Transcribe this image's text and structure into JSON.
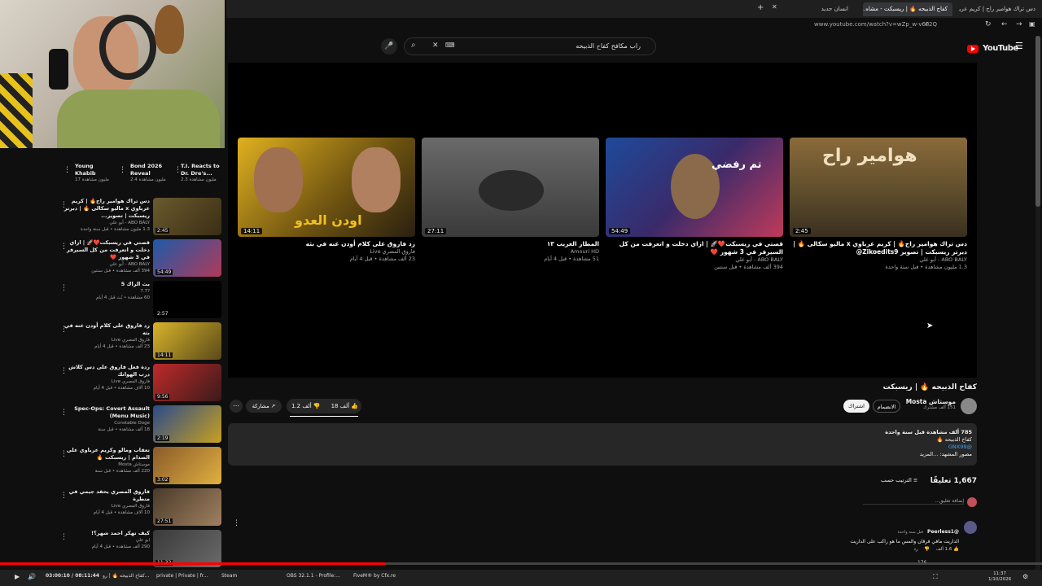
{
  "tabs": [
    {
      "label": "دس تراك هوامير راح | كريم عرباوي x ..."
    },
    {
      "label": "كفاح الذبيحه 🔥 | ريسبكت - مشاه..."
    },
    {
      "label": "انسان جديد"
    }
  ],
  "browser": {
    "url": "www.youtube.com/watch?v=wZp_w-v6F2Q"
  },
  "header": {
    "logo": "YouTube",
    "logo_sup": "SA",
    "search_query": "راب مكافح كفاح الذبيحه"
  },
  "end_screen": [
    {
      "title": "دس تراك هوامير راح🔥 | كريم عرباوي x ماليو سكالى 🔥 | دبرتر ريسبكت | تصوير Zikoedits9@",
      "channel": "ABO BALY - أبو علي",
      "meta": "1.3 مليون مشاهدة • قبل سنة واحدة",
      "duration": "2:45"
    },
    {
      "title": "قصتي في ريسبكت❤️🚀 | ازاي دخلت و اتعرفت من كل السيرفر في 3 شهور ❤️",
      "channel": "ABO BALY - أبو علي",
      "meta": "394 ألف مشاهدة • قبل سنتين",
      "duration": "54:49"
    },
    {
      "title": "المطار الغريب ١٣",
      "channel": "Amouri HD",
      "meta": "51 مشاهدة • قبل 4 أيام",
      "duration": "27:11"
    },
    {
      "title": "رد فاروق على كلام أودن عنه في بثه",
      "channel": "فاروق المصري Live",
      "meta": "23 ألف مشاهدة • قبل 4 أيام",
      "duration": "14:11"
    }
  ],
  "video": {
    "title": "كفاح الذبيحه 🔥 | ريسبكت",
    "channel": "موستاش Mosta",
    "subs": "151 ألف مشترك",
    "join_label": "الانضمام",
    "subscribe_label": "اشتراك",
    "likes": "18 ألف",
    "dislikes": "1.2 ألف",
    "share_label": "مشاركة",
    "desc_views": "785 ألف مشاهدة  قبل سنة واحدة",
    "desc_line1": "كفاح الذبيحه 🔥",
    "desc_handle": "@GNX99",
    "desc_line3": "مصور المشهد: ...المزيد"
  },
  "comments": {
    "count": "1,667 تعليقًا",
    "sort_label": "الترتيب حسب",
    "add_placeholder": "إضافة تعليق...",
    "first_user": "@Peerless1",
    "first_time": "قبل سنة واحدة",
    "first_text": "الداريت مافي فرقان والمس ما هو راكب على الداريت",
    "first_likes": "1.6 ألف",
    "reply_label": "رد",
    "replies_count": "176"
  },
  "sidebar_top": [
    {
      "title": "T.I. Reacts to Dr. Dre's...",
      "meta": "2.3 مليون مشاهدة"
    },
    {
      "title": "Bond 2026 Reveal",
      "meta": "2.4 مليون مشاهدة"
    },
    {
      "title": "Young Khabib",
      "meta": "17 مليون مشاهدة"
    }
  ],
  "sidebar": [
    {
      "title": "دس تراك هوامير راح🔥 | كريم عرباوي x ماليو سكالى 🔥 | دبرتر ريسبكت | تصوير...",
      "channel": "ABO BALY - أبو علي",
      "meta": "1.3 مليون مشاهدة • قبل سنة واحدة",
      "duration": "2:45"
    },
    {
      "title": "قصتي في ريسبكت❤️🚀 | ازاي دخلت و اتعرفت من كل السيرفر في 3 شهور ❤️",
      "channel": "ABO BALY - أبو علي",
      "meta": "394 ألف مشاهدة • قبل سنتين",
      "duration": "54:49"
    },
    {
      "title": "بث الراك 5",
      "channel": "?7.7",
      "meta": "60 مشاهدة • بُث قبل 4 أيام",
      "duration": "2:57"
    },
    {
      "title": "رد فاروق على كلام أودن عنه في بثه",
      "channel": "فاروق المصري Live",
      "meta": "23 ألف مشاهدة • قبل 4 أيام",
      "duration": "14:11"
    },
    {
      "title": "ردة فعل فاروق على دس كلاش درب الهوانك",
      "channel": "فاروق المصري Live",
      "meta": "10 آلاف مشاهدة • قبل 4 أيام",
      "duration": "9:56"
    },
    {
      "title": "Spec-Ops: Covert Assault (Menu Music)",
      "channel": "Constable Doge",
      "meta": "18 ألف مشاهدة • قبل سنة",
      "duration": "2:19"
    },
    {
      "title": "تعقاب ومالو وكريم عرباوي على الصدام | ريسبكت 🔥",
      "channel": "موستاش Mosta",
      "meta": "220 ألف مشاهدة • قبل سنة",
      "duration": "3:02"
    },
    {
      "title": "فاروق المصري يحقد جيمي في متطرة",
      "channel": "فاروق المصري Live",
      "meta": "10 آلاف مشاهدة • قبل 4 أيام",
      "duration": "27:51"
    },
    {
      "title": "كيف تهكر احمد شهر؟!",
      "channel": "ابو علي",
      "meta": "290 ألف مشاهدة • قبل 4 أيام",
      "duration": "11:32"
    }
  ],
  "player_bar": {
    "time": "03:00:10 / 08:11:44"
  },
  "taskbar": [
    {
      "label": "كفاح الذبيحه 🔥 | رو..."
    },
    {
      "label": "private | Private | fr..."
    },
    {
      "label": "Steam"
    },
    {
      "label": "OBS 32.1.1 - Profile:..."
    },
    {
      "label": "FiveM® by Cfx.re"
    }
  ],
  "clock": {
    "time": "11:37",
    "date": "1/10/2026"
  }
}
